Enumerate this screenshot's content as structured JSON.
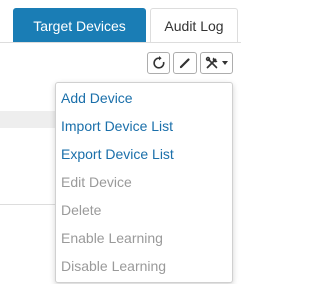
{
  "tabs": [
    {
      "label": "Target Devices",
      "active": true
    },
    {
      "label": "Audit Log",
      "active": false
    }
  ],
  "toolbar": {
    "buttons": [
      {
        "name": "refresh-button",
        "icon": "refresh-icon"
      },
      {
        "name": "edit-button",
        "icon": "pencil-icon"
      },
      {
        "name": "tools-dropdown-button",
        "icon": "tools-icon",
        "caret": "caret-down-icon"
      }
    ]
  },
  "menu": {
    "items": [
      {
        "label": "Add Device",
        "enabled": true
      },
      {
        "label": "Import Device List",
        "enabled": true
      },
      {
        "label": "Export Device List",
        "enabled": true
      },
      {
        "label": "Edit Device",
        "enabled": false
      },
      {
        "label": "Delete",
        "enabled": false
      },
      {
        "label": "Enable Learning",
        "enabled": false
      },
      {
        "label": "Disable Learning",
        "enabled": false
      }
    ]
  },
  "colors": {
    "accent": "#1a7db5",
    "link": "#1a6faa",
    "disabled_text": "#9a9a9a"
  }
}
